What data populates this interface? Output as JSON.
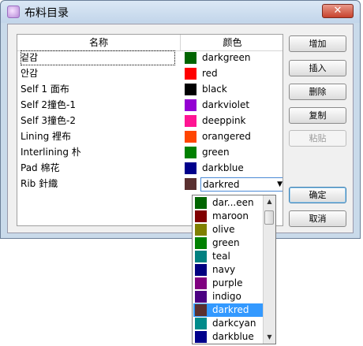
{
  "window": {
    "title": "布料目录",
    "close_glyph": "✕"
  },
  "table": {
    "headers": {
      "name": "名称",
      "color": "颜色"
    },
    "rows": [
      {
        "name": "겉감",
        "color_name": "darkgreen",
        "color_hex": "#006400",
        "selected": true
      },
      {
        "name": "안감",
        "color_name": "red",
        "color_hex": "#ff0000"
      },
      {
        "name": "Self 1 面布",
        "color_name": "black",
        "color_hex": "#000000"
      },
      {
        "name": "Self 2撞色-1",
        "color_name": "darkviolet",
        "color_hex": "#9400d3"
      },
      {
        "name": "Self 3撞色-2",
        "color_name": "deeppink",
        "color_hex": "#ff1493"
      },
      {
        "name": "Lining 裡布",
        "color_name": "orangered",
        "color_hex": "#ff4500"
      },
      {
        "name": "Interlining 朴",
        "color_name": "green",
        "color_hex": "#008000"
      },
      {
        "name": "Pad 棉花",
        "color_name": "darkblue",
        "color_hex": "#00008b"
      },
      {
        "name": "Rib 針織",
        "color_name": "darkred",
        "color_hex": "#5a3030",
        "editing": true
      }
    ]
  },
  "buttons": {
    "add": "增加",
    "insert": "插入",
    "delete": "删除",
    "copy": "复制",
    "paste": "粘贴",
    "ok": "确定",
    "cancel": "取消"
  },
  "combo": {
    "value": "darkred",
    "arrow": "▼"
  },
  "dropdown": {
    "items": [
      {
        "label": "dar...een",
        "color_hex": "#006400"
      },
      {
        "label": "maroon",
        "color_hex": "#800000"
      },
      {
        "label": "olive",
        "color_hex": "#808000"
      },
      {
        "label": "green",
        "color_hex": "#008000"
      },
      {
        "label": "teal",
        "color_hex": "#008080"
      },
      {
        "label": "navy",
        "color_hex": "#000080"
      },
      {
        "label": "purple",
        "color_hex": "#800080"
      },
      {
        "label": "indigo",
        "color_hex": "#4b0082"
      },
      {
        "label": "darkred",
        "color_hex": "#5a3030",
        "selected": true
      },
      {
        "label": "darkcyan",
        "color_hex": "#008b8b"
      },
      {
        "label": "darkblue",
        "color_hex": "#00008b"
      }
    ],
    "scroll_up": "▲",
    "scroll_down": "▼"
  }
}
